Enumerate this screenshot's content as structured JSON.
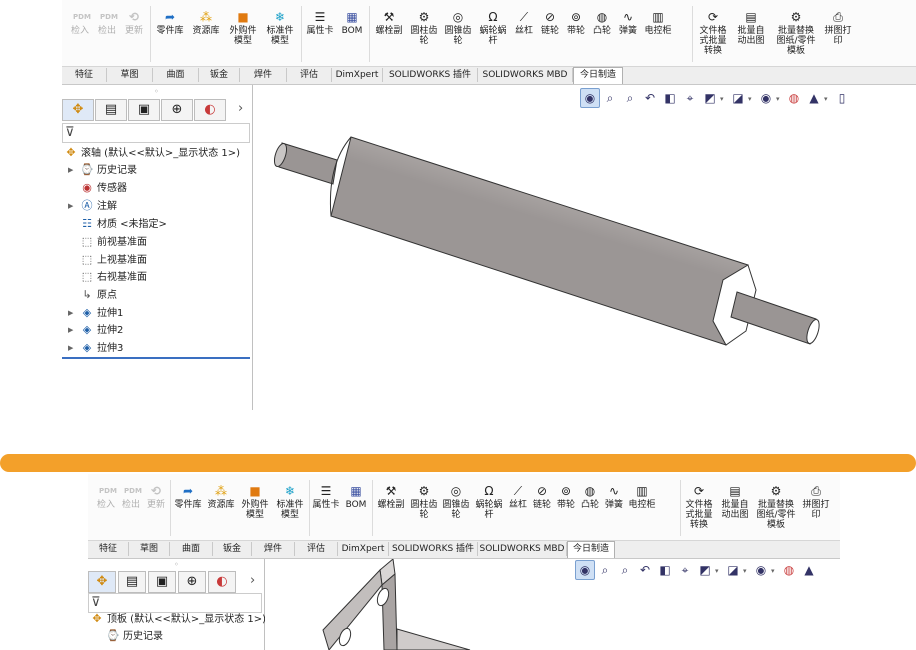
{
  "colors": {
    "accent_bar": "#f3a02a",
    "tree_selection": "#3a6fc1",
    "part_grey": "#c2bebd"
  },
  "ribbon": {
    "disabled_buttons": [
      {
        "label": "检入",
        "icon": "pdm-icon"
      },
      {
        "label": "检出",
        "icon": "pdm-icon"
      },
      {
        "label": "更新",
        "icon": "refresh-icon"
      }
    ],
    "group1": [
      {
        "label": "零件库",
        "icon": "part-library-icon"
      },
      {
        "label": "资源库",
        "icon": "resource-library-icon"
      },
      {
        "label": "外购件\n模型",
        "icon": "purchased-part-icon"
      },
      {
        "label": "标准件\n模型",
        "icon": "standard-part-icon"
      }
    ],
    "group2": [
      {
        "label": "属性卡",
        "icon": "property-card-icon"
      },
      {
        "label": "BOM",
        "icon": "bom-icon"
      }
    ],
    "group3": [
      {
        "label": "螺栓副",
        "icon": "bolt-icon"
      },
      {
        "label": "圆柱齿\n轮",
        "icon": "spur-gear-icon"
      },
      {
        "label": "圆锥齿\n轮",
        "icon": "bevel-gear-icon"
      },
      {
        "label": "蜗轮蜗\n杆",
        "icon": "worm-gear-icon"
      },
      {
        "label": "丝杠",
        "icon": "lead-screw-icon"
      },
      {
        "label": "链轮",
        "icon": "sprocket-icon"
      },
      {
        "label": "带轮",
        "icon": "pulley-icon"
      },
      {
        "label": "凸轮",
        "icon": "cam-icon"
      },
      {
        "label": "弹簧",
        "icon": "spring-icon"
      },
      {
        "label": "电控柜",
        "icon": "cabinet-icon"
      }
    ],
    "group4": [
      {
        "label": "文件格\n式批量\n转换",
        "icon": "batch-convert-icon"
      },
      {
        "label": "批量自\n动出图",
        "icon": "batch-drawing-icon"
      },
      {
        "label": "批量替换\n图纸/零件\n模板",
        "icon": "batch-replace-icon"
      },
      {
        "label": "拼图打\n印",
        "icon": "print-icon"
      }
    ]
  },
  "tabs": [
    "特征",
    "草图",
    "曲面",
    "钣金",
    "焊件",
    "评估",
    "DimXpert",
    "SOLIDWORKS 插件",
    "SOLIDWORKS MBD",
    "今日制造"
  ],
  "active_tab": "今日制造",
  "panel_tabs": [
    "feature-manager-icon",
    "property-manager-icon",
    "config-manager-icon",
    "dimxpert-icon",
    "appearance-icon"
  ],
  "window1": {
    "root": "滚轴 (默认<<默认>_显示状态 1>)",
    "items": [
      {
        "label": "历史记录",
        "icon": "history-icon",
        "expandable": true
      },
      {
        "label": "传感器",
        "icon": "sensor-icon",
        "expandable": false
      },
      {
        "label": "注解",
        "icon": "annotation-icon",
        "expandable": true
      },
      {
        "label": "材质 <未指定>",
        "icon": "material-icon",
        "expandable": false
      },
      {
        "label": "前视基准面",
        "icon": "plane-icon",
        "expandable": false
      },
      {
        "label": "上视基准面",
        "icon": "plane-icon",
        "expandable": false
      },
      {
        "label": "右视基准面",
        "icon": "plane-icon",
        "expandable": false
      },
      {
        "label": "原点",
        "icon": "origin-icon",
        "expandable": false
      },
      {
        "label": "拉伸1",
        "icon": "extrude-icon",
        "expandable": true
      },
      {
        "label": "拉伸2",
        "icon": "extrude-icon",
        "expandable": true
      },
      {
        "label": "拉伸3",
        "icon": "extrude-icon",
        "expandable": true
      }
    ]
  },
  "window2": {
    "root": "顶板 (默认<<默认>_显示状态 1>)",
    "items": [
      {
        "label": "历史记录",
        "icon": "history-icon",
        "expandable": true
      }
    ]
  }
}
